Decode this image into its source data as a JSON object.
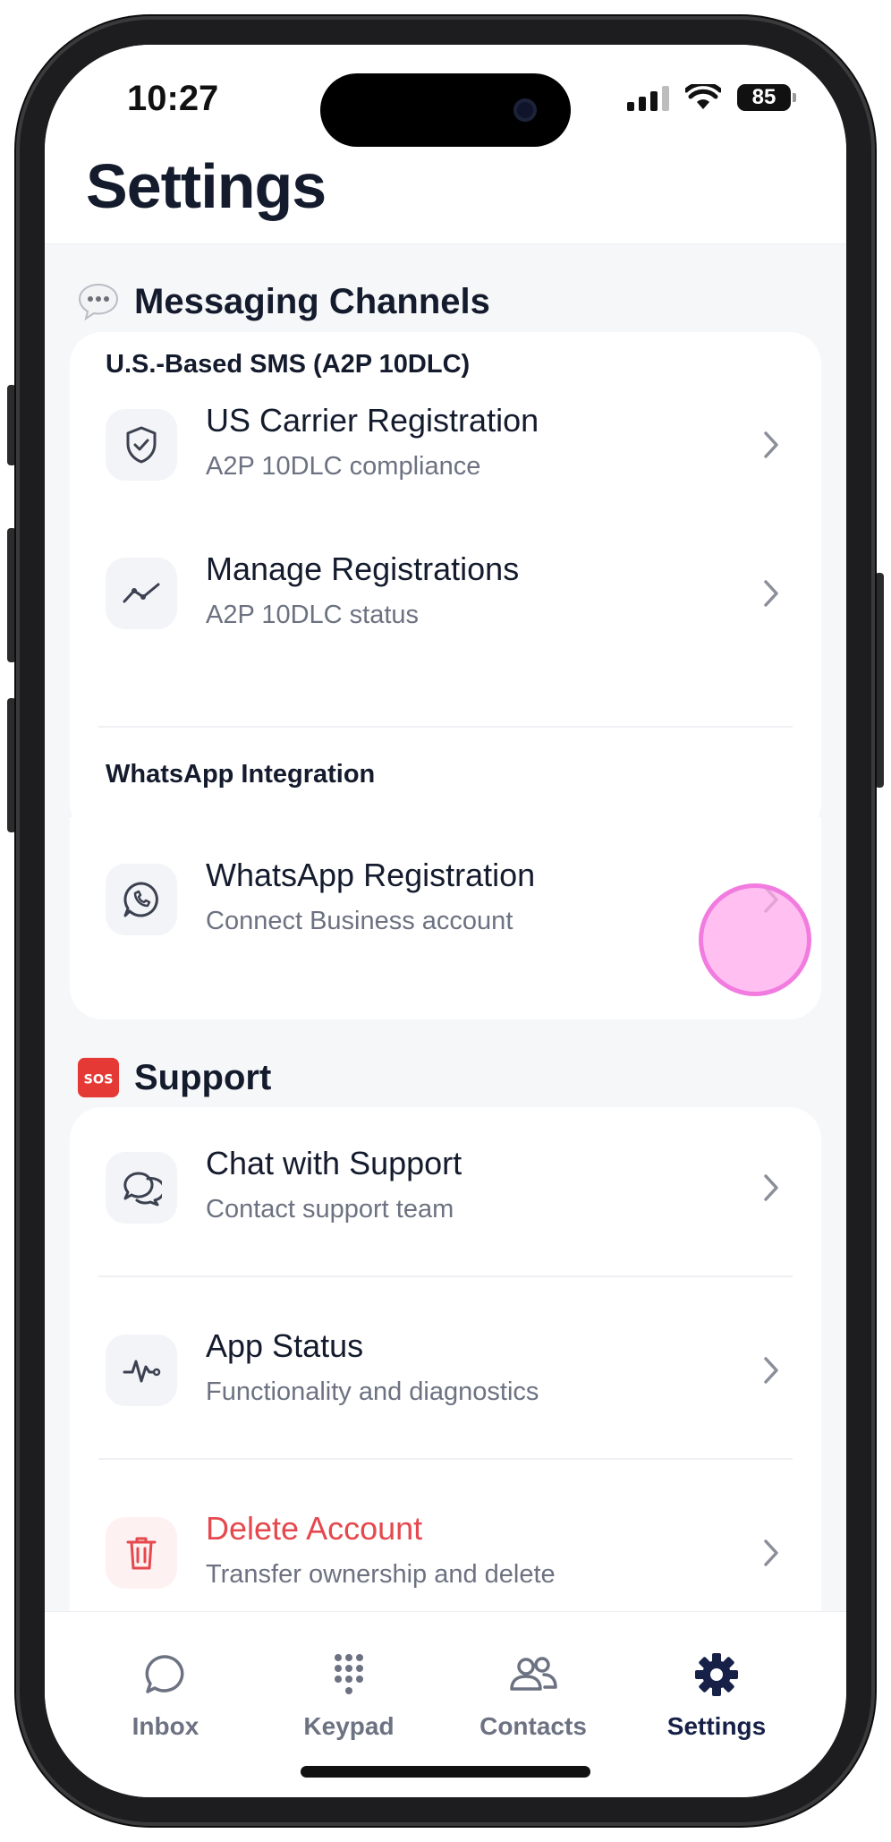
{
  "status": {
    "time": "10:27",
    "battery": "85"
  },
  "header": {
    "title": "Settings"
  },
  "sections": {
    "messaging": {
      "emoji": "💬",
      "title": "Messaging Channels",
      "groups": {
        "sms": {
          "label": "U.S.-Based SMS (A2P 10DLC)",
          "items": [
            {
              "title": "US Carrier Registration",
              "subtitle": "A2P 10DLC compliance",
              "icon": "shield-check-icon"
            },
            {
              "title": "Manage Registrations",
              "subtitle": "A2P 10DLC status",
              "icon": "trend-line-icon"
            }
          ]
        },
        "whatsapp": {
          "label": "WhatsApp Integration",
          "items": [
            {
              "title": "WhatsApp Registration",
              "subtitle": "Connect Business account",
              "icon": "whatsapp-icon"
            }
          ]
        }
      }
    },
    "support": {
      "emoji": "SOS",
      "title": "Support",
      "items": [
        {
          "title": "Chat with Support",
          "subtitle": "Contact support team",
          "icon": "chat-bubbles-icon"
        },
        {
          "title": "App Status",
          "subtitle": "Functionality and diagnostics",
          "icon": "pulse-icon"
        },
        {
          "title": "Delete Account",
          "subtitle": "Transfer ownership and delete",
          "icon": "trash-icon"
        }
      ]
    }
  },
  "tabs": [
    {
      "label": "Inbox",
      "icon": "chat-bubble-icon",
      "active": false
    },
    {
      "label": "Keypad",
      "icon": "keypad-icon",
      "active": false
    },
    {
      "label": "Contacts",
      "icon": "contacts-icon",
      "active": false
    },
    {
      "label": "Settings",
      "icon": "gear-icon",
      "active": true
    }
  ],
  "colors": {
    "primary_text": "#141b2d",
    "secondary_text": "#6c7281",
    "danger": "#e5484d",
    "active_tab": "#172148",
    "tap_highlight": "#f27be0"
  }
}
